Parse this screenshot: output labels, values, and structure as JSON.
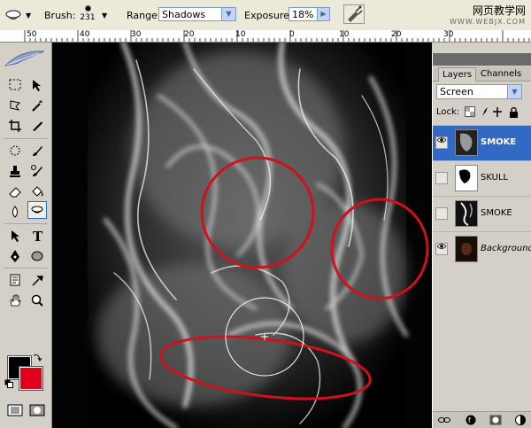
{
  "options_bar": {
    "tool_icon": "dodge-burn-icon",
    "brush_label": "Brush:",
    "brush_size": "231",
    "range_label": "Range:",
    "range_value": "Shadows",
    "exposure_label": "Exposure:",
    "exposure_value": "18%",
    "airbrush_icon": "airbrush-icon"
  },
  "watermark": {
    "title": "网页教学网",
    "url": "WWW.WEBJX.COM"
  },
  "ruler": {
    "labels": [
      "50",
      "40",
      "30",
      "20",
      "10",
      "0",
      "10",
      "20",
      "30"
    ]
  },
  "toolbox": {
    "foreground_color": "#000000",
    "background_color": "#e0001a"
  },
  "layers_panel": {
    "tabs": [
      "Layers",
      "Channels"
    ],
    "active_tab": "Layers",
    "blend_mode": "Screen",
    "lock_label": "Lock:",
    "layers": [
      {
        "name": "SMOKE",
        "visible": true,
        "selected": true
      },
      {
        "name": "SKULL",
        "visible": false,
        "selected": false
      },
      {
        "name": "SMOKE",
        "visible": false,
        "selected": false
      },
      {
        "name": "Background",
        "visible": true,
        "selected": false
      }
    ]
  },
  "colors": {
    "selection": "#316ac5",
    "annotation_red": "#d0101a"
  }
}
